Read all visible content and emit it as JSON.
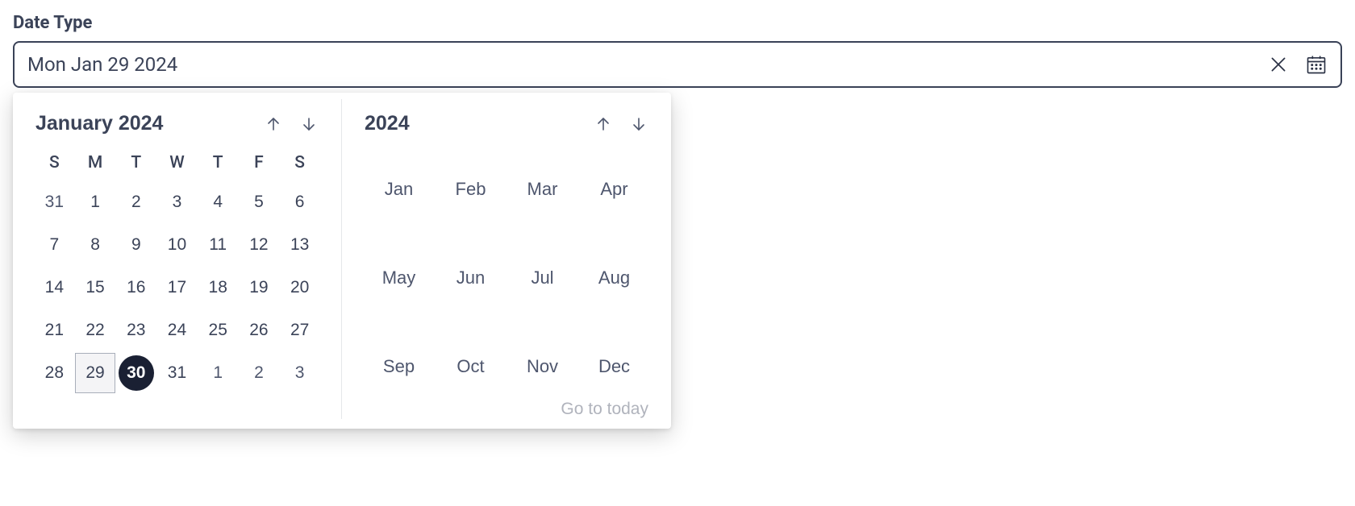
{
  "field": {
    "label": "Date Type",
    "value": "Mon Jan 29 2024"
  },
  "calendar": {
    "title": "January 2024",
    "weekdays": [
      "S",
      "M",
      "T",
      "W",
      "T",
      "F",
      "S"
    ],
    "grid": [
      [
        {
          "d": "31",
          "muted": true
        },
        {
          "d": "1"
        },
        {
          "d": "2"
        },
        {
          "d": "3"
        },
        {
          "d": "4"
        },
        {
          "d": "5"
        },
        {
          "d": "6"
        }
      ],
      [
        {
          "d": "7"
        },
        {
          "d": "8"
        },
        {
          "d": "9"
        },
        {
          "d": "10"
        },
        {
          "d": "11"
        },
        {
          "d": "12"
        },
        {
          "d": "13"
        }
      ],
      [
        {
          "d": "14"
        },
        {
          "d": "15"
        },
        {
          "d": "16"
        },
        {
          "d": "17"
        },
        {
          "d": "18"
        },
        {
          "d": "19"
        },
        {
          "d": "20"
        }
      ],
      [
        {
          "d": "21"
        },
        {
          "d": "22"
        },
        {
          "d": "23"
        },
        {
          "d": "24"
        },
        {
          "d": "25"
        },
        {
          "d": "26"
        },
        {
          "d": "27"
        }
      ],
      [
        {
          "d": "28"
        },
        {
          "d": "29",
          "selected": true
        },
        {
          "d": "30",
          "today": true
        },
        {
          "d": "31"
        },
        {
          "d": "1",
          "muted": true
        },
        {
          "d": "2",
          "muted": true
        },
        {
          "d": "3",
          "muted": true
        }
      ]
    ]
  },
  "yearPanel": {
    "title": "2024",
    "months": [
      "Jan",
      "Feb",
      "Mar",
      "Apr",
      "May",
      "Jun",
      "Jul",
      "Aug",
      "Sep",
      "Oct",
      "Nov",
      "Dec"
    ],
    "goToToday": "Go to today"
  }
}
